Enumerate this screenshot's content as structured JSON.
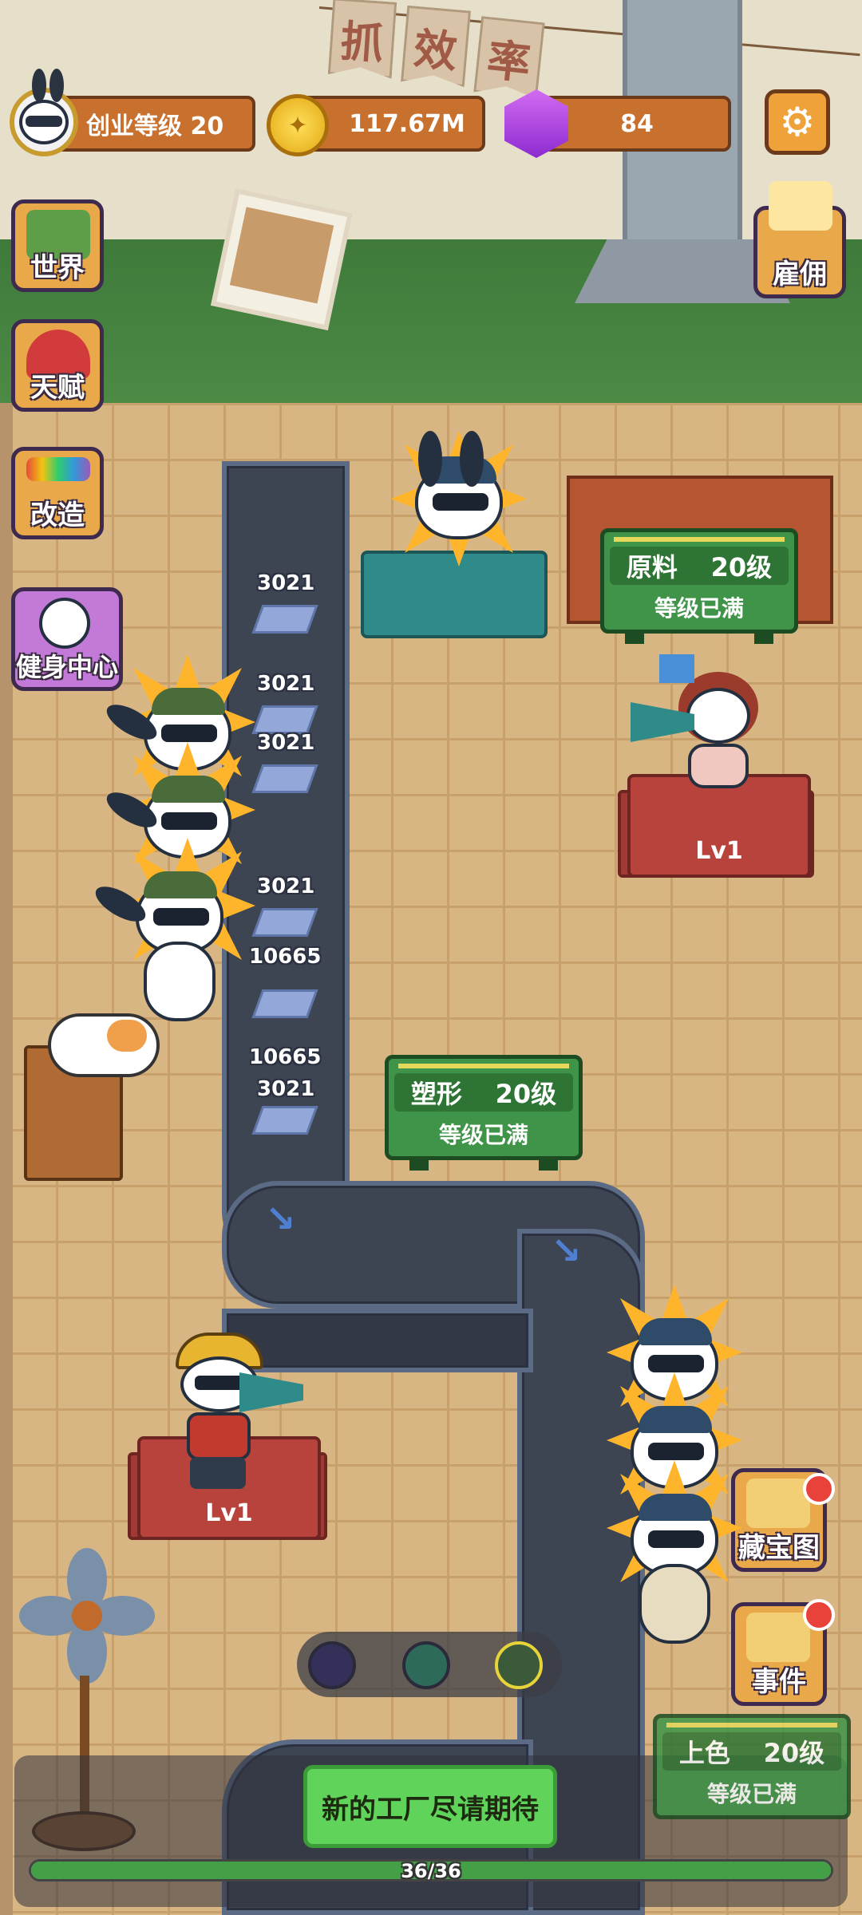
{
  "hud": {
    "level_label": "创业等级 20",
    "coins": "117.67M",
    "gems": "84",
    "settings_icon": "gear-icon"
  },
  "banner": {
    "chars": [
      "抓",
      "效",
      "率"
    ]
  },
  "side_menu": {
    "world": "世界",
    "talent": "天赋",
    "renovate": "改造",
    "gym": "健身中心",
    "hire": "雇佣",
    "treasure_map": "藏宝图",
    "events": "事件"
  },
  "stations": {
    "raw": {
      "name": "原料",
      "level": "20级",
      "status": "等级已满"
    },
    "shaping": {
      "name": "塑形",
      "level": "20级",
      "status": "等级已满"
    },
    "coloring": {
      "name": "上色",
      "level": "20级",
      "status": "等级已满"
    }
  },
  "desks": {
    "top_right": "Lv1",
    "bottom_left": "Lv1"
  },
  "belt_items": [
    "3021",
    "3021",
    "3021",
    "3021",
    "10665",
    "10665",
    "3021"
  ],
  "bottom": {
    "cta": "新的工厂尽请期待",
    "progress_text": "36/36",
    "progress_fraction": 1.0
  },
  "colors": {
    "accent_orange": "#c8702e",
    "station_green": "#3f9449",
    "desk_red": "#b8433d",
    "cta_green": "#5fd35a"
  }
}
